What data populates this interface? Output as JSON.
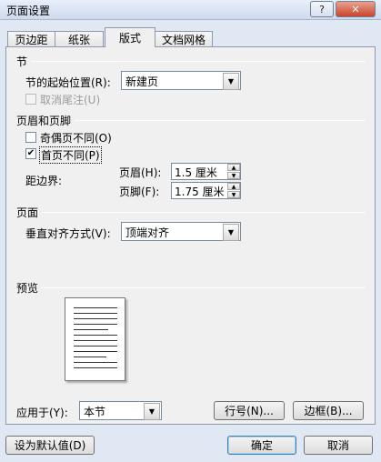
{
  "window": {
    "title": "页面设置",
    "help_glyph": "?",
    "close_glyph": "✕"
  },
  "tabs": [
    {
      "label": "页边距",
      "active": false
    },
    {
      "label": "纸张",
      "active": false
    },
    {
      "label": "版式",
      "active": true
    },
    {
      "label": "文档网格",
      "active": false
    }
  ],
  "section_node": {
    "heading": "节",
    "start_label": "节的起始位置(R):",
    "start_value": "新建页",
    "suppress_endnotes_label": "取消尾注(U)",
    "suppress_endnotes_checked": false
  },
  "section_header_footer": {
    "heading": "页眉和页脚",
    "odd_even_label": "奇偶页不同(O)",
    "odd_even_checked": false,
    "first_page_label": "首页不同(P)",
    "first_page_checked": true,
    "distance_label": "距边界:",
    "header_label": "页眉(H):",
    "header_value": "1.5 厘米",
    "footer_label": "页脚(F):",
    "footer_value": "1.75 厘米"
  },
  "section_page": {
    "heading": "页面",
    "valign_label": "垂直对齐方式(V):",
    "valign_value": "顶端对齐"
  },
  "preview": {
    "heading": "预览"
  },
  "apply": {
    "label": "应用于(Y):",
    "value": "本节"
  },
  "buttons": {
    "line_numbers": "行号(N)...",
    "borders": "边框(B)...",
    "set_default": "设为默认值(D)",
    "ok": "确定",
    "cancel": "取消"
  },
  "icons": {
    "dropdown": "chevron-down-icon",
    "checkmark": "checkmark-icon"
  }
}
